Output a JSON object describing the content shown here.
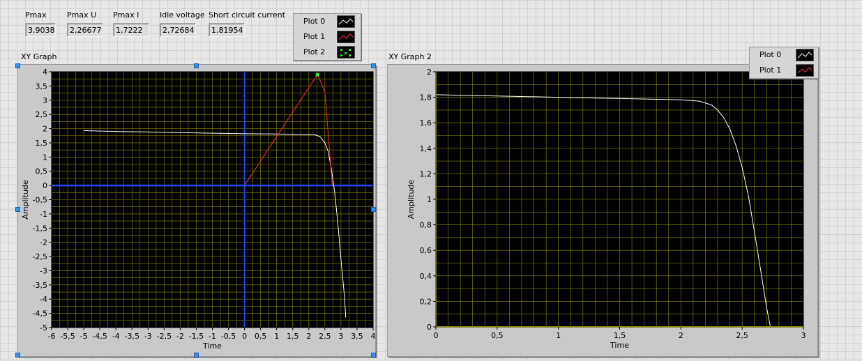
{
  "indicators": [
    {
      "label": "Pmax",
      "value": "3,90383"
    },
    {
      "label": "Pmax U",
      "value": "2,26677"
    },
    {
      "label": "Pmax I",
      "value": "1,7222"
    },
    {
      "label": "Idle voltage",
      "value": "2,72684"
    },
    {
      "label": "Short  circuit current",
      "value": "1,81954"
    }
  ],
  "legend_top": [
    "Plot 0",
    "Plot 1",
    "Plot 2"
  ],
  "legend_graph2": [
    "Plot 0",
    "Plot 1"
  ],
  "colors": {
    "plot_bg": "#000000",
    "grid": "#8a8a00",
    "plot0": "#ffffff",
    "plot1": "#ff3030",
    "plot2": "#33dd33",
    "cursor": "#2244ff",
    "axis_zero": "#ffff00"
  },
  "graph1": {
    "title": "XY Graph",
    "xlabel": "Time",
    "ylabel": "Amplitude",
    "x_ticks": [
      "-6",
      "-5,5",
      "-5",
      "-4,5",
      "-4",
      "-3,5",
      "-3",
      "-2,5",
      "-2",
      "-1,5",
      "-1",
      "-0,5",
      "0",
      "0,5",
      "1",
      "1,5",
      "2",
      "2,5",
      "3",
      "3,5",
      "4"
    ],
    "y_ticks": [
      "4",
      "3,5",
      "3",
      "2,5",
      "2",
      "1,5",
      "1",
      "0,5",
      "0",
      "-0,5",
      "-1",
      "-1,5",
      "-2",
      "-2,5",
      "-3",
      "-3,5",
      "-4",
      "-4,5",
      "-5"
    ]
  },
  "graph2": {
    "title": "XY Graph 2",
    "xlabel": "Time",
    "ylabel": "Amplitude",
    "x_ticks": [
      "0",
      "0,5",
      "1",
      "1,5",
      "2",
      "2,5",
      "3"
    ],
    "y_ticks": [
      "2",
      "1,8",
      "1,6",
      "1,4",
      "1,2",
      "1",
      "0,8",
      "0,6",
      "0,4",
      "0,2",
      "0"
    ]
  },
  "chart_data": [
    {
      "type": "line",
      "title": "XY Graph",
      "xlabel": "Time",
      "ylabel": "Amplitude",
      "xlim": [
        -6,
        4
      ],
      "ylim": [
        -5,
        4
      ],
      "grid": true,
      "series": [
        {
          "name": "Plot 0",
          "x": [
            -5,
            -4,
            -3,
            -2,
            -1,
            0,
            1,
            1.5,
            2,
            2.2,
            2.35,
            2.5,
            2.6,
            2.7,
            2.8,
            2.9,
            3.0,
            3.1,
            3.15
          ],
          "y": [
            1.93,
            1.9,
            1.88,
            1.86,
            1.84,
            1.82,
            1.81,
            1.8,
            1.79,
            1.78,
            1.72,
            1.5,
            1.2,
            0.6,
            -0.2,
            -1.3,
            -2.6,
            -3.8,
            -4.65
          ]
        },
        {
          "name": "Plot 1",
          "x": [
            0,
            2.27,
            2.5,
            2.73
          ],
          "y": [
            0,
            3.904,
            3.3,
            0
          ]
        },
        {
          "name": "Plot 2",
          "x": [
            2.27
          ],
          "y": [
            3.9
          ]
        }
      ]
    },
    {
      "type": "line",
      "title": "XY Graph 2",
      "xlabel": "Time",
      "ylabel": "Amplitude",
      "xlim": [
        0,
        3
      ],
      "ylim": [
        0,
        2
      ],
      "grid": true,
      "series": [
        {
          "name": "Plot 0",
          "x": [
            0,
            0.25,
            0.5,
            0.75,
            1.0,
            1.25,
            1.5,
            1.75,
            2.0,
            2.15,
            2.25,
            2.3,
            2.35,
            2.4,
            2.45,
            2.5,
            2.55,
            2.6,
            2.65,
            2.7,
            2.73
          ],
          "y": [
            1.82,
            1.815,
            1.81,
            1.805,
            1.8,
            1.795,
            1.79,
            1.785,
            1.78,
            1.77,
            1.74,
            1.7,
            1.64,
            1.55,
            1.42,
            1.25,
            1.03,
            0.75,
            0.45,
            0.15,
            0
          ]
        }
      ]
    }
  ]
}
